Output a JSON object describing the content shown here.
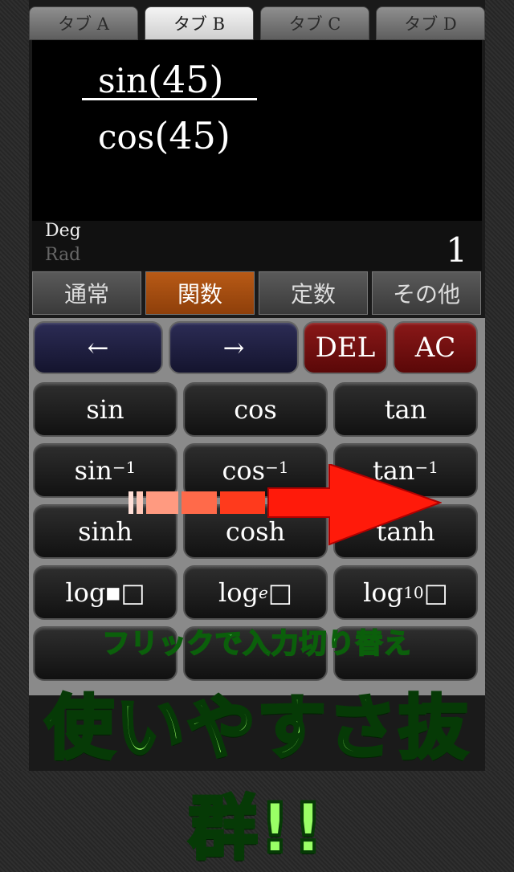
{
  "tabs": [
    "タブ A",
    "タブ B",
    "タブ C",
    "タブ D"
  ],
  "display": {
    "numerator": {
      "func": "sin",
      "open": "(",
      "arg": "45",
      "close": ")"
    },
    "denominator": {
      "func": "cos",
      "open": "(",
      "arg": "45",
      "close": ")"
    },
    "mode_deg": "Deg",
    "mode_rad": "Rad",
    "result": "1"
  },
  "modes": [
    "通常",
    "関数",
    "定数",
    "その他"
  ],
  "nav": {
    "left": "←",
    "right": "→",
    "del": "DEL",
    "ac": "AC"
  },
  "keys": {
    "row1": [
      "sin",
      "cos",
      "tan"
    ],
    "row2": [
      {
        "base": "sin",
        "sup": "−1"
      },
      {
        "base": "cos",
        "sup": "−1"
      },
      {
        "base": "tan",
        "sup": "−1"
      }
    ],
    "row3": [
      "sinh",
      "cosh",
      "tanh"
    ],
    "row4": [
      {
        "base": "log",
        "sub": "■",
        "box": "□"
      },
      {
        "base": "log",
        "sub": "e",
        "box": "□"
      },
      {
        "base": "log",
        "sub": "10",
        "box": "□"
      }
    ]
  },
  "banner": {
    "subtitle": "フリックで入力切り替え",
    "headline": "使いやすさ抜群!!"
  },
  "colors": {
    "active_mode": "#b85a16",
    "nav_key": "#2c2c55",
    "red_key": "#8a1818",
    "arrow": "#ff1a0a",
    "headline": "#9aff66"
  }
}
